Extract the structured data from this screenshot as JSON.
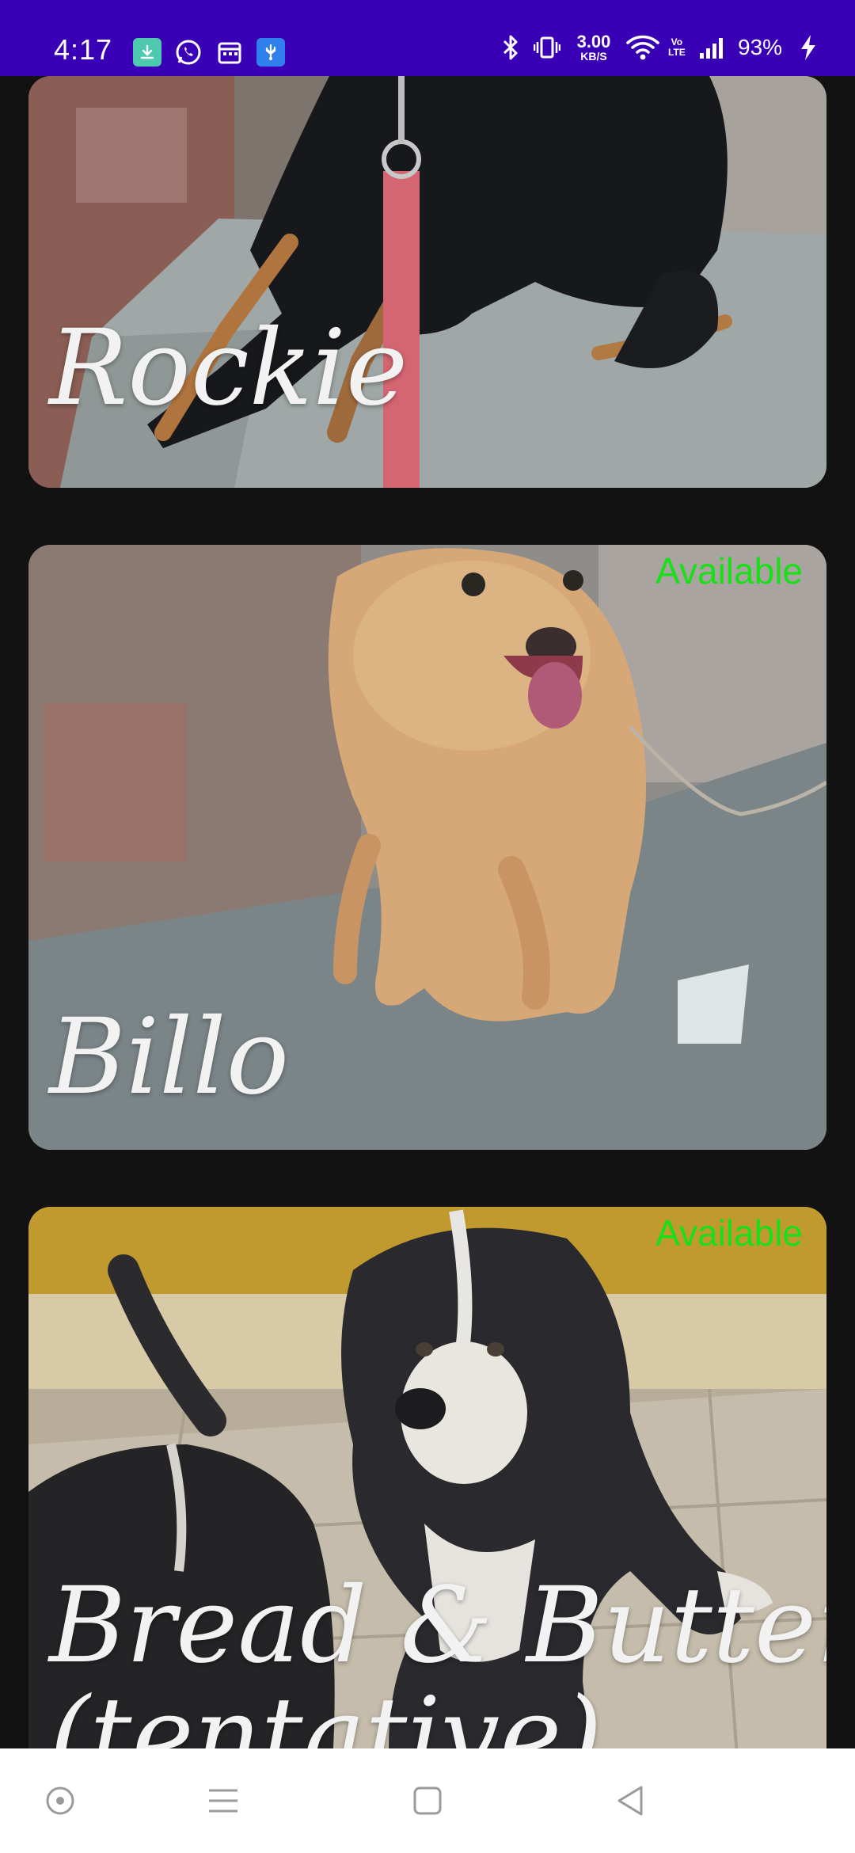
{
  "status_bar": {
    "time": "4:17",
    "net_speed_value": "3.00",
    "net_speed_unit": "KB/S",
    "volte_top": "Vo",
    "volte_bottom": "LTE",
    "battery": "93%",
    "notification_icons": [
      "download-icon",
      "whatsapp-icon",
      "calendar-icon",
      "usb-icon"
    ],
    "status_icons": [
      "bluetooth-icon",
      "vibrate-icon",
      "wifi-icon",
      "signal-icon",
      "charging-icon"
    ],
    "background_color": "#3a00b5"
  },
  "feed": {
    "cards": [
      {
        "name": "Rockie",
        "status": ""
      },
      {
        "name": "Billo",
        "status": "Available"
      },
      {
        "name_line1": "Bread & Butter",
        "name_line2": "(tentative)",
        "status": "Available"
      }
    ],
    "status_color": "#18e018"
  },
  "nav_bar": {
    "buttons": [
      "assistant-icon",
      "menu-icon",
      "home-icon",
      "back-icon"
    ]
  }
}
